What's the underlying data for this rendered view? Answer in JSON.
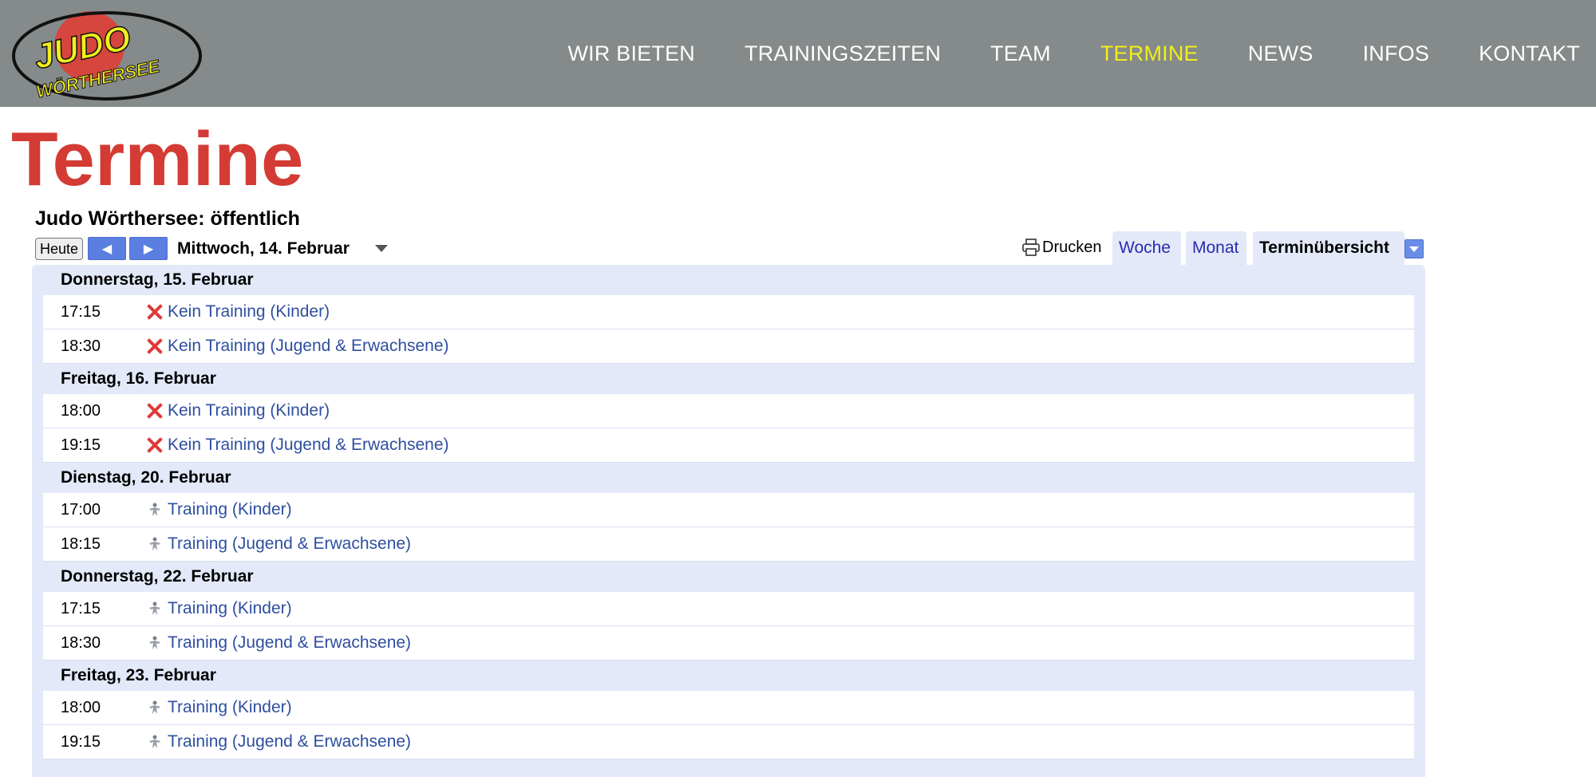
{
  "header": {
    "logo": {
      "line1": "JUDO",
      "line2": "WÖRTHERSEE"
    },
    "nav": [
      {
        "label": "WIR BIETEN"
      },
      {
        "label": "TRAININGSZEITEN"
      },
      {
        "label": "TEAM"
      },
      {
        "label": "TERMINE",
        "active": true
      },
      {
        "label": "NEWS"
      },
      {
        "label": "INFOS"
      },
      {
        "label": "KONTAKT"
      }
    ]
  },
  "page_title": "Termine",
  "calendar": {
    "title": "Judo Wörthersee: öffentlich",
    "today_label": "Heute",
    "current_date": "Mittwoch, 14. Februar",
    "print_label": "Drucken",
    "tabs": [
      {
        "label": "Woche"
      },
      {
        "label": "Monat"
      },
      {
        "label": "Terminübersicht",
        "active": true
      }
    ],
    "days": [
      {
        "date": "Donnerstag, 15. Februar",
        "events": [
          {
            "time": "17:15",
            "title": "Kein Training (Kinder)",
            "icon": "x-icon"
          },
          {
            "time": "18:30",
            "title": "Kein Training (Jugend & Erwachsene)",
            "icon": "x-icon"
          }
        ]
      },
      {
        "date": "Freitag, 16. Februar",
        "events": [
          {
            "time": "18:00",
            "title": "Kein Training (Kinder)",
            "icon": "x-icon"
          },
          {
            "time": "19:15",
            "title": "Kein Training (Jugend & Erwachsene)",
            "icon": "x-icon"
          }
        ]
      },
      {
        "date": "Dienstag, 20. Februar",
        "events": [
          {
            "time": "17:00",
            "title": "Training (Kinder)",
            "icon": "judo-icon"
          },
          {
            "time": "18:15",
            "title": "Training (Jugend & Erwachsene)",
            "icon": "judo-icon"
          }
        ]
      },
      {
        "date": "Donnerstag, 22. Februar",
        "events": [
          {
            "time": "17:15",
            "title": "Training (Kinder)",
            "icon": "judo-icon"
          },
          {
            "time": "18:30",
            "title": "Training (Jugend & Erwachsene)",
            "icon": "judo-icon"
          }
        ]
      },
      {
        "date": "Freitag, 23. Februar",
        "events": [
          {
            "time": "18:00",
            "title": "Training (Kinder)",
            "icon": "judo-icon"
          },
          {
            "time": "19:15",
            "title": "Training (Jugend & Erwachsene)",
            "icon": "judo-icon"
          }
        ]
      }
    ]
  },
  "colors": {
    "header_bg": "#858a8a",
    "nav_active": "#f2ee1c",
    "title": "#d33b34",
    "agenda_bg": "#e3e9f8",
    "event_link": "#2e4ea0",
    "cancel_x": "#e03a3a"
  }
}
